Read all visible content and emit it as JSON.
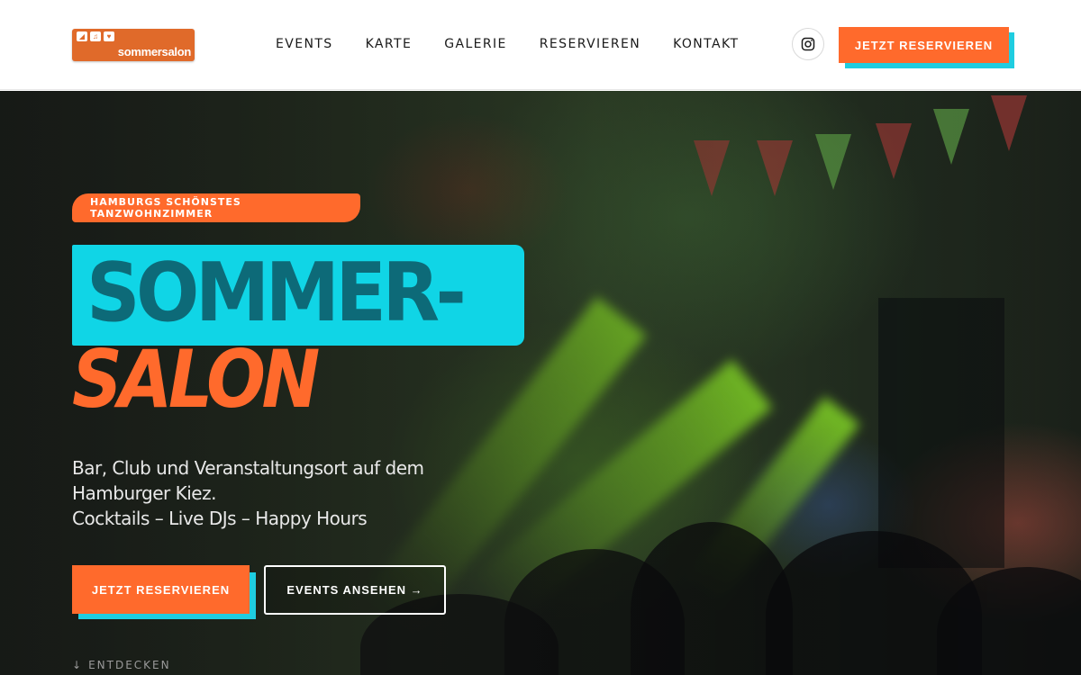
{
  "header": {
    "logo_text": "sommersalon",
    "nav": [
      {
        "label": "EVENTS"
      },
      {
        "label": "KARTE"
      },
      {
        "label": "GALERIE"
      },
      {
        "label": "RESERVIEREN"
      },
      {
        "label": "KONTAKT"
      }
    ],
    "social_icon": "instagram-icon",
    "cta_label": "JETZT RESERVIEREN"
  },
  "hero": {
    "tagline": "HAMBURGS SCHÖNSTES TANZWOHNZIMMER",
    "title_line1": "SOMMER-",
    "title_line2": "SALON",
    "description": [
      "Bar, Club und Veranstaltungsort auf dem",
      "Hamburger Kiez.",
      "Cocktails – Live DJs – Happy Hours"
    ],
    "primary_button": "JETZT RESERVIEREN",
    "secondary_button": "EVENTS ANSEHEN →",
    "scroll_hint": "ENTDECKEN",
    "scroll_icon": "arrow-down-icon"
  },
  "colors": {
    "accent_orange": "#ff6a2c",
    "accent_cyan": "#10d5e6",
    "title_teal": "#0d6a78",
    "logo_orange": "#e06a2a"
  }
}
